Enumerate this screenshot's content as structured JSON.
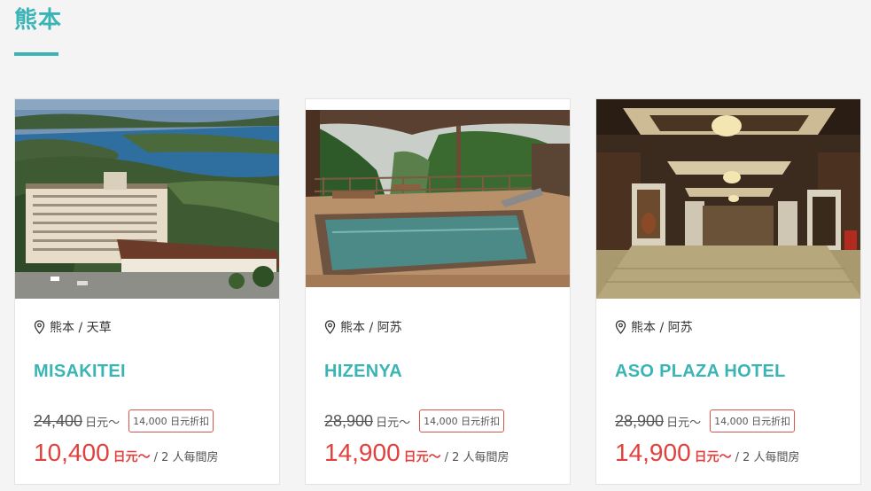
{
  "region": {
    "title": "熊本"
  },
  "cards": [
    {
      "location": "熊本 / 天草",
      "name": "MISAKITEI",
      "original_price": "24,400",
      "original_unit": "日元～",
      "discount": "14,000 日元折扣",
      "price": "10,400",
      "price_unit": "日元～",
      "per_note": "/ 2 人每間房",
      "photo": "coastal-hotel-photo"
    },
    {
      "location": "熊本 / 阿苏",
      "name": "HIZENYA",
      "original_price": "28,900",
      "original_unit": "日元～",
      "discount": "14,000 日元折扣",
      "price": "14,900",
      "price_unit": "日元～",
      "per_note": "/ 2 人每間房",
      "photo": "open-air-bath-photo"
    },
    {
      "location": "熊本 / 阿苏",
      "name": "ASO PLAZA HOTEL",
      "original_price": "28,900",
      "original_unit": "日元～",
      "discount": "14,000 日元折扣",
      "price": "14,900",
      "price_unit": "日元～",
      "per_note": "/ 2 人每間房",
      "photo": "hotel-lobby-photo"
    }
  ],
  "colors": {
    "accent": "#3bb4b6",
    "price_red": "#e0413e",
    "badge_border": "#d9534f"
  },
  "icons": {
    "location": "map-pin-icon"
  }
}
